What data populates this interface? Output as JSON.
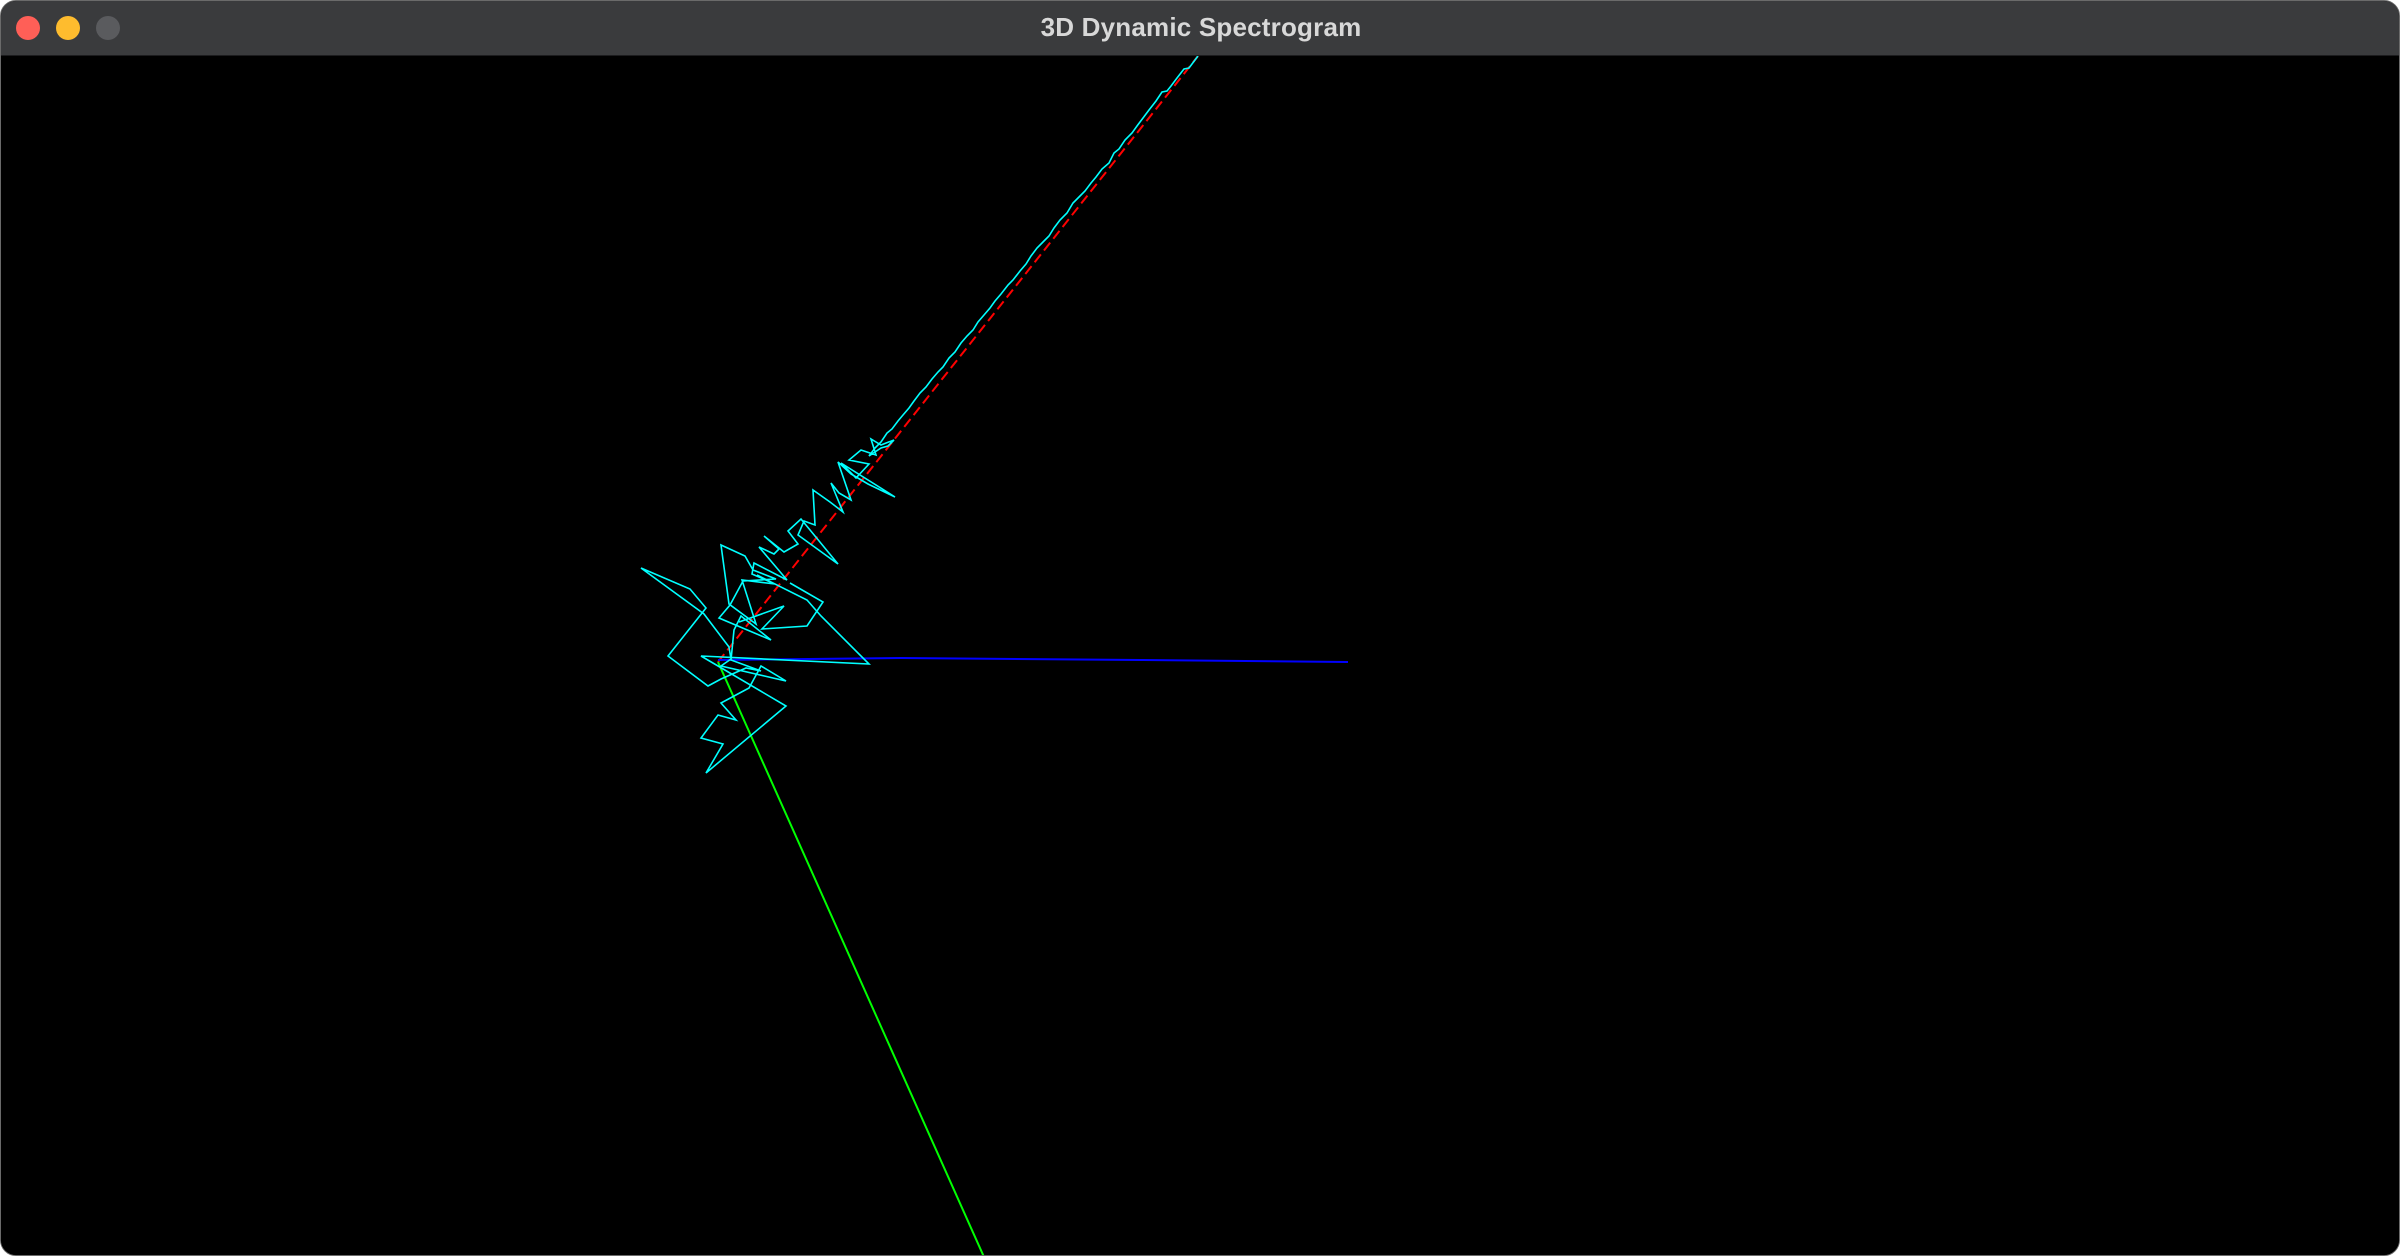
{
  "window": {
    "title": "3D Dynamic Spectrogram"
  },
  "traffic_lights": {
    "close_color": "#ff5f57",
    "minimize_color": "#febc2e",
    "zoom_color": "#5a5b5e"
  },
  "scene": {
    "background": "#000000",
    "axes": [
      {
        "name": "x-axis",
        "color": "#ff0000"
      },
      {
        "name": "y-axis",
        "color": "#00ff00"
      },
      {
        "name": "z-axis",
        "color": "#0000ff"
      }
    ],
    "waveform_color": "#00ffff"
  }
}
